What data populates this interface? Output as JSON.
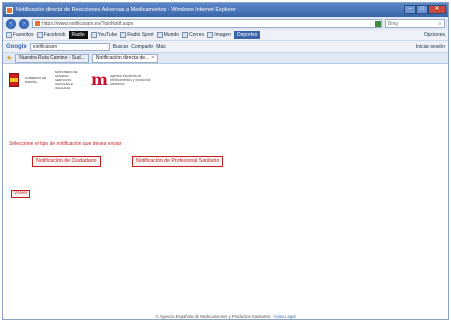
{
  "window": {
    "title": "Notificación directa de Reacciones Adversas a Medicamentos - Windows Internet Explorer",
    "controls": {
      "minimize": "–",
      "maximize": "□",
      "close": "✕"
    }
  },
  "address_bar": {
    "url": "https://www.notificaram.es/TipoNotif.aspx",
    "search_placeholder": "Bing"
  },
  "toolbar1": {
    "items": [
      "Favoritos",
      "Facebook",
      "Radio",
      "YouTube",
      "Radio Sport",
      "Mundo",
      "Correo",
      "Imagen",
      "Deportes"
    ],
    "right": "Opciones"
  },
  "toolbar2": {
    "google_label": "Google",
    "search_value": "notificaram",
    "items": [
      "Buscar",
      "Compartir",
      "Más"
    ],
    "right": "Iniciar sesión"
  },
  "tabs": {
    "items": [
      {
        "label": "Nuestra Ruta Camino - Sud..."
      },
      {
        "label": "Notificación directa de..."
      }
    ]
  },
  "header": {
    "gobierno_text": "GOBIERNO DE ESPAÑA",
    "ministerio_text": "MINISTERIO DE SANIDAD, SERVICIOS SOCIALES E IGUALDAD",
    "agency_mark": "m",
    "agency_text": "agencia española de medicamentos y productos sanitarios"
  },
  "main": {
    "instruction": "Seleccione el tipo de notificación que desea enviar",
    "buttons": {
      "ciudadano": "Notificación de Ciudadano",
      "profesional": "Notificación de Profesional Sanitario",
      "volver": "Volver"
    }
  },
  "footer": {
    "text": "© Agencia Española de Medicamentos y Productos Sanitarios  ·  ",
    "link": "Aviso Legal"
  },
  "colors": {
    "accent_red": "#c81e1e",
    "browser_blue": "#3a64a8"
  }
}
